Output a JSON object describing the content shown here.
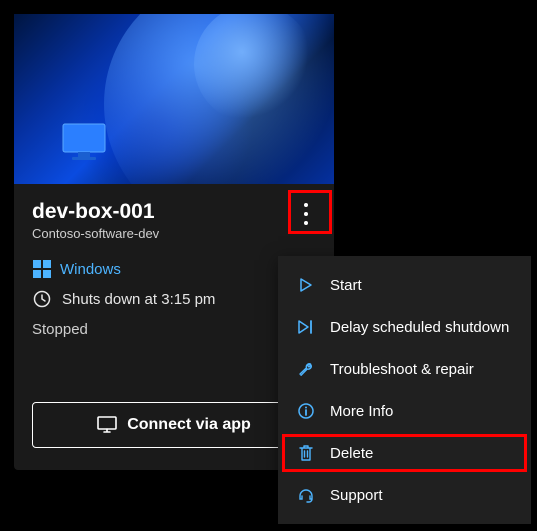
{
  "card": {
    "title": "dev-box-001",
    "subtitle": "Contoso-software-dev",
    "os_label": "Windows",
    "schedule": "Shuts down at 3:15 pm",
    "status": "Stopped",
    "connect_label": "Connect via app"
  },
  "menu": {
    "items": [
      {
        "label": "Start"
      },
      {
        "label": "Delay scheduled shutdown"
      },
      {
        "label": "Troubleshoot & repair"
      },
      {
        "label": "More Info"
      },
      {
        "label": "Delete"
      },
      {
        "label": "Support"
      }
    ]
  },
  "colors": {
    "accent": "#4db4ff",
    "highlight": "#ff0000"
  }
}
